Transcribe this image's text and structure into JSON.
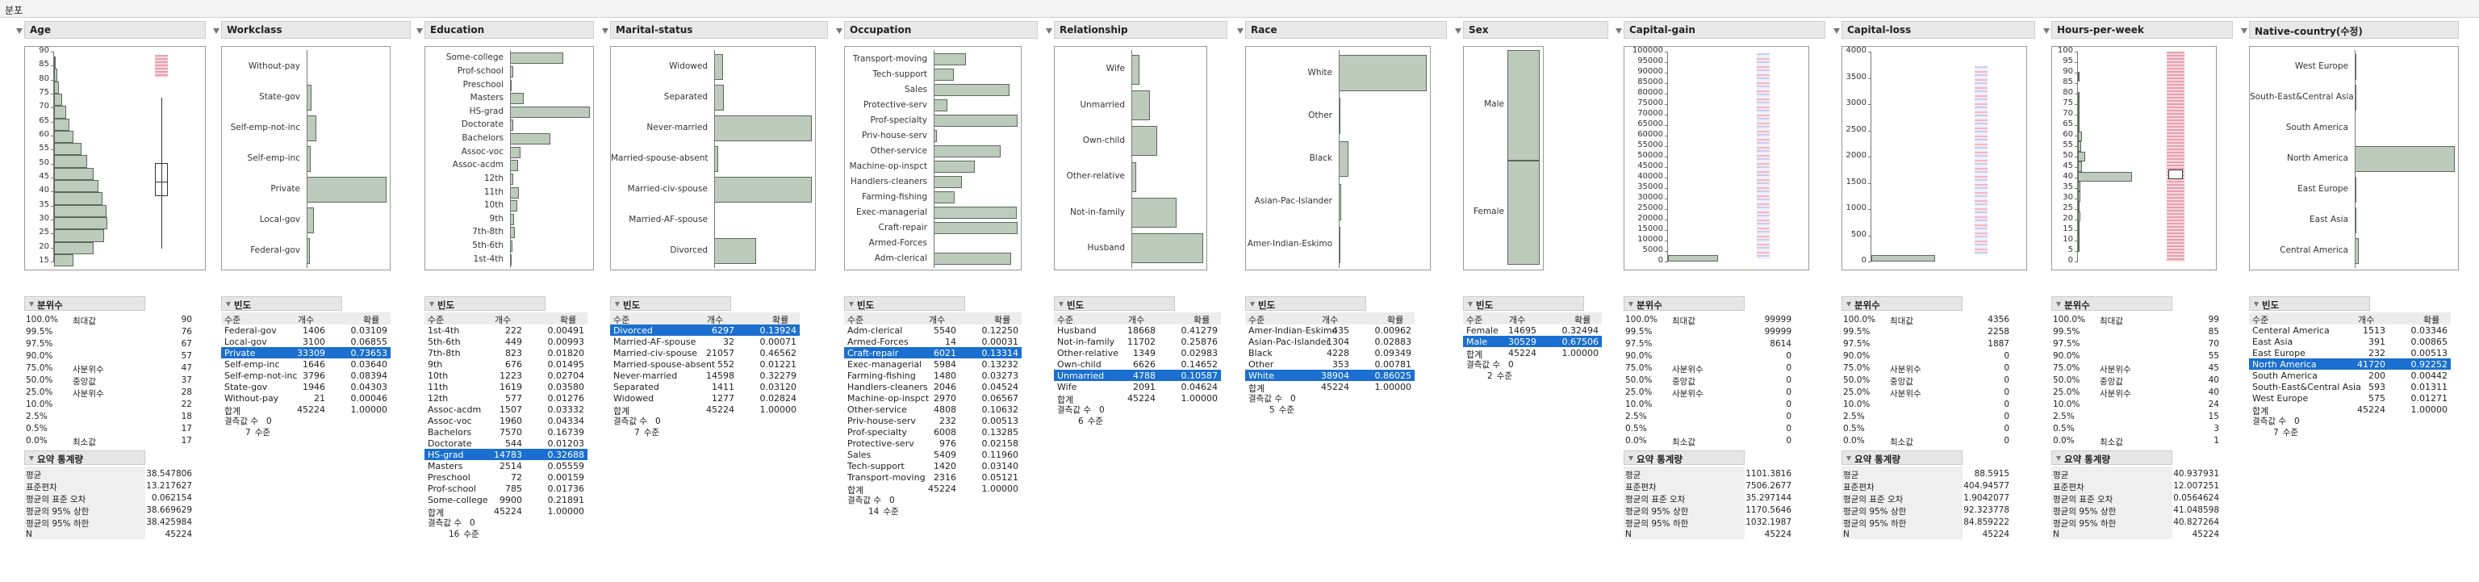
{
  "window": {
    "title": "분포"
  },
  "labels": {
    "freq": "빈도",
    "quant": "분위수",
    "summary": "요약 통계량",
    "level": "수준",
    "count": "개수",
    "prob": "확률",
    "total": "합계",
    "missing": "결측값 수",
    "levels_suffix": "수준"
  },
  "quant_labels": [
    "100.0%",
    "99.5%",
    "97.5%",
    "90.0%",
    "75.0%",
    "50.0%",
    "25.0%",
    "10.0%",
    "2.5%",
    "0.5%",
    "0.0%"
  ],
  "quant_names": [
    "최대값",
    "",
    "",
    "",
    "사분위수",
    "중앙값",
    "사분위수",
    "",
    "",
    "",
    "최소값"
  ],
  "summary_labels": [
    "평균",
    "표준편차",
    "평균의 표준 오차",
    "평균의 95% 상한",
    "평균의 95% 하한",
    "N"
  ],
  "columns": [
    {
      "name": "Age",
      "type": "num",
      "ticks": [
        "90",
        "85",
        "80",
        "75",
        "70",
        "65",
        "60",
        "55",
        "50",
        "45",
        "40",
        "35",
        "30",
        "25",
        "20",
        "15"
      ],
      "hist": [
        0.03,
        0.05,
        0.08,
        0.12,
        0.18,
        0.24,
        0.3,
        0.42,
        0.5,
        0.6,
        0.68,
        0.74,
        0.8,
        0.82,
        0.76,
        0.6,
        0.3
      ],
      "quantiles": [
        "90",
        "76",
        "67",
        "57",
        "47",
        "37",
        "28",
        "22",
        "18",
        "17",
        "17"
      ],
      "summary": [
        "38.547806",
        "13.217627",
        "0.062154",
        "38.669629",
        "38.425984",
        "45224"
      ]
    },
    {
      "name": "Workclass",
      "type": "cat",
      "cats": [
        "Without-pay",
        "State-gov",
        "Self-emp-not-inc",
        "Self-emp-inc",
        "Private",
        "Local-gov",
        "Federal-gov"
      ],
      "bars": [
        0.0,
        0.06,
        0.12,
        0.05,
        1.0,
        0.09,
        0.04
      ],
      "rows": [
        [
          "Federal-gov",
          "1406",
          "0.03109"
        ],
        [
          "Local-gov",
          "3100",
          "0.06855"
        ],
        [
          "Private",
          "33309",
          "0.73653"
        ],
        [
          "Self-emp-inc",
          "1646",
          "0.03640"
        ],
        [
          "Self-emp-not-inc",
          "3796",
          "0.08394"
        ],
        [
          "State-gov",
          "1946",
          "0.04303"
        ],
        [
          "Without-pay",
          "21",
          "0.00046"
        ]
      ],
      "sel": 2,
      "total": [
        "45224",
        "1.00000"
      ],
      "missing": "0",
      "levels": "7"
    },
    {
      "name": "Education",
      "type": "cat",
      "cats": [
        "Some-college",
        "Prof-school",
        "Preschool",
        "Masters",
        "HS-grad",
        "Doctorate",
        "Bachelors",
        "Assoc-voc",
        "Assoc-acdm",
        "12th",
        "11th",
        "10th",
        "9th",
        "7th-8th",
        "5th-6th",
        "1st-4th"
      ],
      "bars": [
        0.67,
        0.04,
        0.01,
        0.17,
        1.0,
        0.04,
        0.51,
        0.13,
        0.1,
        0.04,
        0.11,
        0.09,
        0.05,
        0.06,
        0.03,
        0.02
      ],
      "rows": [
        [
          "1st-4th",
          "222",
          "0.00491"
        ],
        [
          "5th-6th",
          "449",
          "0.00993"
        ],
        [
          "7th-8th",
          "823",
          "0.01820"
        ],
        [
          "9th",
          "676",
          "0.01495"
        ],
        [
          "10th",
          "1223",
          "0.02704"
        ],
        [
          "11th",
          "1619",
          "0.03580"
        ],
        [
          "12th",
          "577",
          "0.01276"
        ],
        [
          "Assoc-acdm",
          "1507",
          "0.03332"
        ],
        [
          "Assoc-voc",
          "1960",
          "0.04334"
        ],
        [
          "Bachelors",
          "7570",
          "0.16739"
        ],
        [
          "Doctorate",
          "544",
          "0.01203"
        ],
        [
          "HS-grad",
          "14783",
          "0.32688"
        ],
        [
          "Masters",
          "2514",
          "0.05559"
        ],
        [
          "Preschool",
          "72",
          "0.00159"
        ],
        [
          "Prof-school",
          "785",
          "0.01736"
        ],
        [
          "Some-college",
          "9900",
          "0.21891"
        ]
      ],
      "sel": 11,
      "total": [
        "45224",
        "1.00000"
      ],
      "missing": "0",
      "levels": "16"
    },
    {
      "name": "Marital-status",
      "type": "cat",
      "cats": [
        "Widowed",
        "Separated",
        "Never-married",
        "Married-spouse-absent",
        "Married-civ-spouse",
        "Married-AF-spouse",
        "Divorced"
      ],
      "bars": [
        0.09,
        0.1,
        1.0,
        0.04,
        1.44,
        0.0,
        0.43
      ],
      "rows": [
        [
          "Divorced",
          "6297",
          "0.13924"
        ],
        [
          "Married-AF-spouse",
          "32",
          "0.00071"
        ],
        [
          "Married-civ-spouse",
          "21057",
          "0.46562"
        ],
        [
          "Married-spouse-absent",
          "552",
          "0.01221"
        ],
        [
          "Never-married",
          "14598",
          "0.32279"
        ],
        [
          "Separated",
          "1411",
          "0.03120"
        ],
        [
          "Widowed",
          "1277",
          "0.02824"
        ]
      ],
      "sel": 0,
      "total": [
        "45224",
        "1.00000"
      ],
      "missing": "0",
      "levels": "7"
    },
    {
      "name": "Occupation",
      "type": "cat",
      "cats": [
        "Transport-moving",
        "Tech-support",
        "Sales",
        "Protective-serv",
        "Prof-specialty",
        "Priv-house-serv",
        "Other-service",
        "Machine-op-inspct",
        "Handlers-cleaners",
        "Farming-fishing",
        "Exec-managerial",
        "Craft-repair",
        "Armed-Forces",
        "Adm-clerical"
      ],
      "bars": [
        0.38,
        0.24,
        0.9,
        0.16,
        1.0,
        0.04,
        0.8,
        0.49,
        0.34,
        0.25,
        0.99,
        1.0,
        0.0,
        0.92
      ],
      "rows": [
        [
          "Adm-clerical",
          "5540",
          "0.12250"
        ],
        [
          "Armed-Forces",
          "14",
          "0.00031"
        ],
        [
          "Craft-repair",
          "6021",
          "0.13314"
        ],
        [
          "Exec-managerial",
          "5984",
          "0.13232"
        ],
        [
          "Farming-fishing",
          "1480",
          "0.03273"
        ],
        [
          "Handlers-cleaners",
          "2046",
          "0.04524"
        ],
        [
          "Machine-op-inspct",
          "2970",
          "0.06567"
        ],
        [
          "Other-service",
          "4808",
          "0.10632"
        ],
        [
          "Priv-house-serv",
          "232",
          "0.00513"
        ],
        [
          "Prof-specialty",
          "6008",
          "0.13285"
        ],
        [
          "Protective-serv",
          "976",
          "0.02158"
        ],
        [
          "Sales",
          "5409",
          "0.11960"
        ],
        [
          "Tech-support",
          "1420",
          "0.03140"
        ],
        [
          "Transport-moving",
          "2316",
          "0.05121"
        ]
      ],
      "sel": 2,
      "total": [
        "45224",
        "1.00000"
      ],
      "missing": "0",
      "levels": "14"
    },
    {
      "name": "Relationship",
      "type": "cat",
      "cats": [
        "Wife",
        "Unmarried",
        "Own-child",
        "Other-relative",
        "Not-in-family",
        "Husband"
      ],
      "bars": [
        0.11,
        0.26,
        0.36,
        0.07,
        0.63,
        1.0
      ],
      "rows": [
        [
          "Husband",
          "18668",
          "0.41279"
        ],
        [
          "Not-in-family",
          "11702",
          "0.25876"
        ],
        [
          "Other-relative",
          "1349",
          "0.02983"
        ],
        [
          "Own-child",
          "6626",
          "0.14652"
        ],
        [
          "Unmarried",
          "4788",
          "0.10587"
        ],
        [
          "Wife",
          "2091",
          "0.04624"
        ]
      ],
      "sel": 4,
      "total": [
        "45224",
        "1.00000"
      ],
      "missing": "0",
      "levels": "6"
    },
    {
      "name": "Race",
      "type": "cat",
      "cats": [
        "White",
        "Other",
        "Black",
        "Asian-Pac-Islander",
        "Amer-Indian-Eskimo"
      ],
      "bars": [
        1.0,
        0.01,
        0.11,
        0.03,
        0.01
      ],
      "rows": [
        [
          "Amer-Indian-Eskimo",
          "435",
          "0.00962"
        ],
        [
          "Asian-Pac-Islander",
          "1304",
          "0.02883"
        ],
        [
          "Black",
          "4228",
          "0.09349"
        ],
        [
          "Other",
          "353",
          "0.00781"
        ],
        [
          "White",
          "38904",
          "0.86025"
        ]
      ],
      "sel": 4,
      "total": [
        "45224",
        "1.00000"
      ],
      "missing": "0",
      "levels": "5"
    },
    {
      "name": "Sex",
      "type": "mosaic",
      "cats": [
        "Male",
        "Female"
      ],
      "split": 0.4855,
      "rows": [
        [
          "Female",
          "14695",
          "0.32494"
        ],
        [
          "Male",
          "30529",
          "0.67506"
        ]
      ],
      "sel": 1,
      "total": [
        "45224",
        "1.00000"
      ],
      "missing": "0",
      "levels": "2"
    },
    {
      "name": "Capital-gain",
      "type": "num",
      "ticks": [
        "100000",
        "95000",
        "90000",
        "85000",
        "80000",
        "75000",
        "70000",
        "65000",
        "60000",
        "55000",
        "50000",
        "45000",
        "40000",
        "35000",
        "30000",
        "25000",
        "20000",
        "15000",
        "10000",
        "5000",
        "0"
      ],
      "hist": [
        1.0
      ],
      "quantiles": [
        "99999",
        "99999",
        "8614",
        "0",
        "0",
        "0",
        "0",
        "0",
        "0",
        "0",
        "0"
      ],
      "summary": [
        "1101.3816",
        "7506.2677",
        "35.297144",
        "1170.5646",
        "1032.1987",
        "45224"
      ]
    },
    {
      "name": "Capital-loss",
      "type": "num",
      "ticks": [
        "4000",
        "3500",
        "3000",
        "2500",
        "2000",
        "1500",
        "1000",
        "500",
        "0"
      ],
      "hist": [
        1.0
      ],
      "quantiles": [
        "4356",
        "2258",
        "1887",
        "0",
        "0",
        "0",
        "0",
        "0",
        "0",
        "0",
        "0"
      ],
      "summary": [
        "88.5915",
        "404.94577",
        "1.9042077",
        "92.323778",
        "84.859222",
        "45224"
      ]
    },
    {
      "name": "Hours-per-week",
      "type": "num",
      "ticks": [
        "100",
        "95",
        "90",
        "85",
        "80",
        "75",
        "70",
        "65",
        "60",
        "55",
        "50",
        "45",
        "40",
        "35",
        "30",
        "25",
        "20",
        "15",
        "10",
        "5",
        "0"
      ],
      "hist": [
        0.0,
        0.0,
        0.01,
        0.0,
        0.02,
        0.01,
        0.02,
        0.02,
        0.08,
        0.06,
        0.14,
        0.07,
        1.0,
        0.05,
        0.05,
        0.03,
        0.04,
        0.02,
        0.01,
        0.01,
        0.0
      ],
      "quantiles": [
        "99",
        "85",
        "70",
        "55",
        "45",
        "40",
        "40",
        "24",
        "15",
        "3",
        "1"
      ],
      "summary": [
        "40.937931",
        "12.007251",
        "0.0564624",
        "41.048598",
        "40.827264",
        "45224"
      ]
    },
    {
      "name": "Native-country(수정)",
      "type": "cat",
      "cats": [
        "West Europe",
        "South-East&Central Asia",
        "South America",
        "North America",
        "East Europe",
        "East Asia",
        "Central America"
      ],
      "bars": [
        0.01,
        0.01,
        0.0,
        1.0,
        0.01,
        0.01,
        0.04
      ],
      "rows": [
        [
          "Centeral America",
          "1513",
          "0.03346"
        ],
        [
          "East Asia",
          "391",
          "0.00865"
        ],
        [
          "East Europe",
          "232",
          "0.00513"
        ],
        [
          "North America",
          "41720",
          "0.92252"
        ],
        [
          "South America",
          "200",
          "0.00442"
        ],
        [
          "South-East&Central Asia",
          "593",
          "0.01311"
        ],
        [
          "West Europe",
          "575",
          "0.01271"
        ]
      ],
      "sel": 3,
      "total": [
        "45224",
        "1.00000"
      ],
      "missing": "0",
      "levels": "7"
    }
  ]
}
